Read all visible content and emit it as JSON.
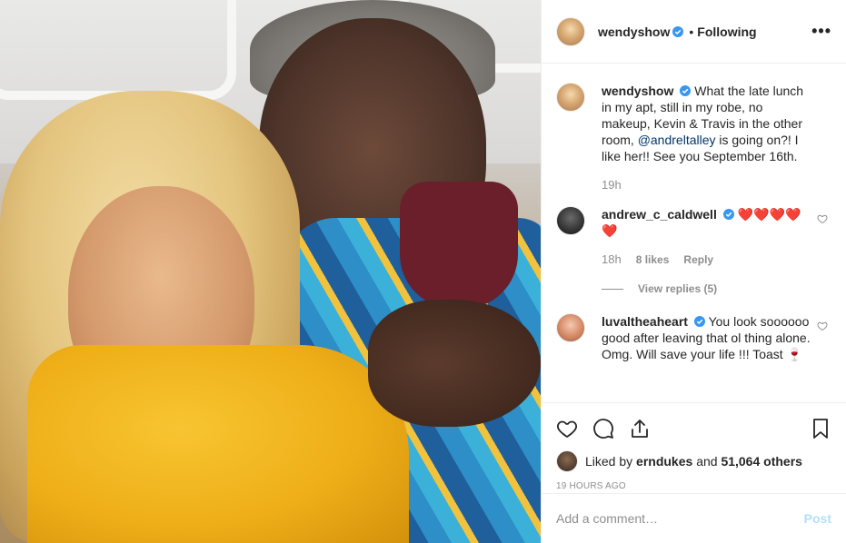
{
  "post": {
    "username": "wendyshow",
    "follow_separator": "•",
    "follow_status": "Following",
    "more_label": "•••"
  },
  "caption": {
    "username": "wendyshow",
    "text_before": "What the late lunch in my apt, still in my robe, no makeup, Kevin & Travis in the other room,",
    "mention": "@andreltalley",
    "text_after": "is going on?! I like her!! See you September 16th.",
    "time": "19h"
  },
  "comments": [
    {
      "username": "andrew_c_caldwell",
      "text": "❤️❤️❤️❤️❤️",
      "time": "18h",
      "likes": "8 likes",
      "reply_label": "Reply",
      "view_replies": "View replies (5)"
    },
    {
      "username": "luvaltheaheart",
      "text": "You look soooooo good after leaving that ol thing alone. Omg. Will save your life !!! Toast 🍷"
    }
  ],
  "likes": {
    "prefix": "Liked by",
    "user": "erndukes",
    "middle": "and",
    "others": "51,064 others"
  },
  "posted_ago": "19 HOURS AGO",
  "add_comment": {
    "placeholder": "Add a comment…",
    "post_label": "Post"
  },
  "colors": {
    "verified": "#3897f0",
    "mention": "#00376b",
    "post_disabled": "#b2dffc",
    "muted": "#8e8e8e"
  }
}
